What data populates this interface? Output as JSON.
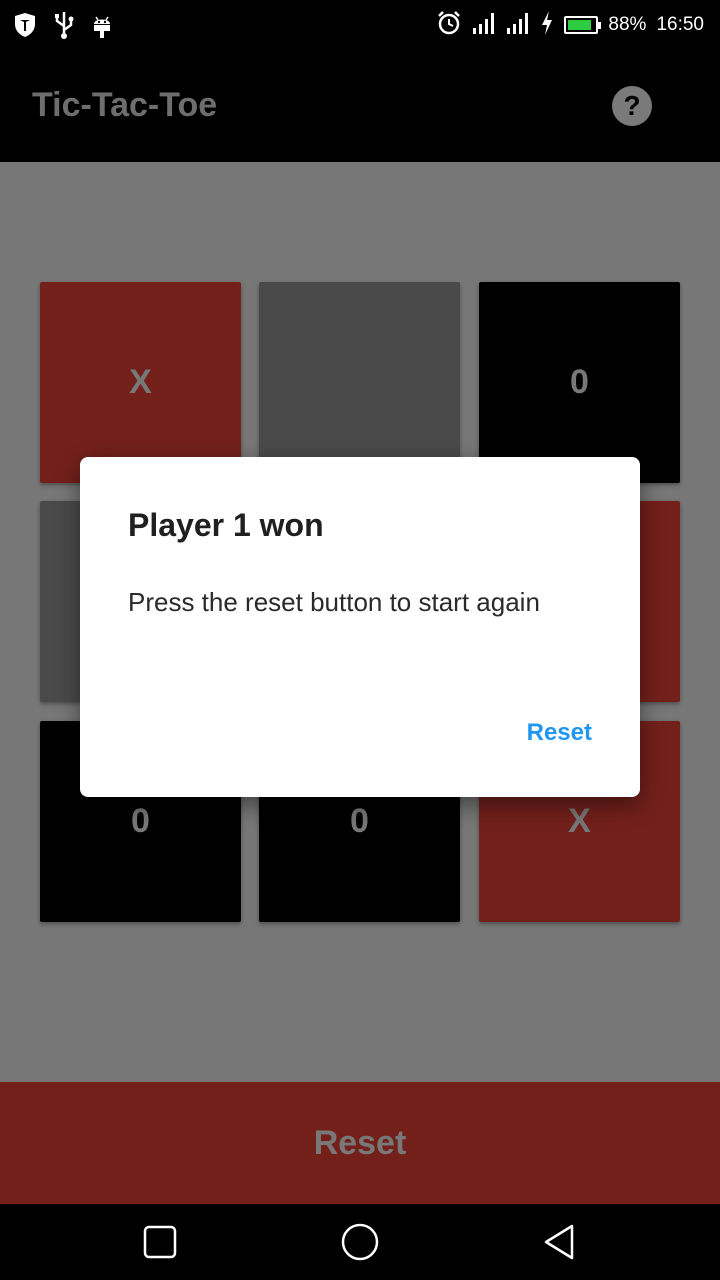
{
  "status_bar": {
    "battery_percent": "88%",
    "battery_level": 0.88,
    "time": "16:50",
    "left_icons": [
      "shield-icon",
      "usb-icon",
      "android-debug-icon"
    ],
    "right_icons": [
      "alarm-icon",
      "signal-icon",
      "signal-icon",
      "charging-icon",
      "battery-icon"
    ]
  },
  "app_bar": {
    "title": "Tic-Tac-Toe",
    "help_label": "?"
  },
  "board": {
    "cells": [
      {
        "mark": "X",
        "color": "#73201b"
      },
      {
        "mark": "",
        "color": "#4a4a4a"
      },
      {
        "mark": "0",
        "color": "#000000"
      },
      {
        "mark": "",
        "color": "#4a4a4a"
      },
      {
        "mark": "",
        "color": "#4a4a4a"
      },
      {
        "mark": "",
        "color": "#73201b"
      },
      {
        "mark": "0",
        "color": "#000000"
      },
      {
        "mark": "0",
        "color": "#000000"
      },
      {
        "mark": "X",
        "color": "#73201b"
      }
    ]
  },
  "reset_button": {
    "label": "Reset"
  },
  "dialog": {
    "title": "Player 1 won",
    "message": "Press the reset button to start again",
    "action_label": "Reset",
    "action_color": "#2196f3"
  },
  "nav_bar": {
    "icons": [
      "recent-apps-icon",
      "home-icon",
      "back-icon"
    ]
  },
  "colors": {
    "player_x": "#73201b",
    "player_o": "#000000",
    "empty": "#4a4a4a",
    "background": "#777777"
  }
}
